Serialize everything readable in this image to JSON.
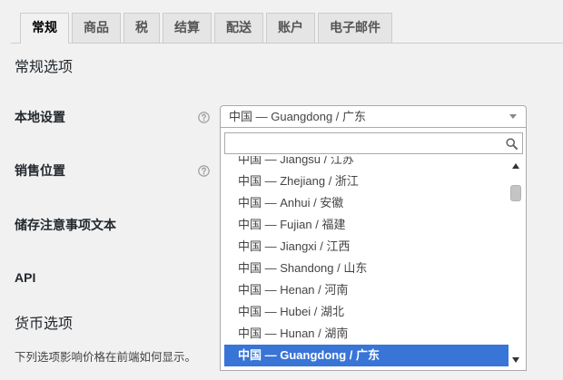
{
  "tabs": [
    {
      "label": "常规",
      "active": true
    },
    {
      "label": "商品",
      "active": false
    },
    {
      "label": "税",
      "active": false
    },
    {
      "label": "结算",
      "active": false
    },
    {
      "label": "配送",
      "active": false
    },
    {
      "label": "账户",
      "active": false
    },
    {
      "label": "电子邮件",
      "active": false
    }
  ],
  "general_options": {
    "heading": "常规选项",
    "fields": {
      "base_location": {
        "label": "本地设置",
        "help_icon": "help-icon"
      },
      "selling_location": {
        "label": "销售位置",
        "help_icon": "help-icon"
      },
      "store_notice_text": {
        "label": "储存注意事项文本"
      },
      "api": {
        "label": "API"
      }
    }
  },
  "base_location_select": {
    "selected": "中国 — Guangdong / 广东",
    "open": true,
    "search_value": "",
    "highlighted_index": 9,
    "options": [
      "中国 — Jiangsu / 江苏",
      "中国 — Zhejiang / 浙江",
      "中国 — Anhui / 安徽",
      "中国 — Fujian / 福建",
      "中国 — Jiangxi / 江西",
      "中国 — Shandong / 山东",
      "中国 — Henan / 河南",
      "中国 — Hubei / 湖北",
      "中国 — Hunan / 湖南",
      "中国 — Guangdong / 广东"
    ]
  },
  "currency_options": {
    "heading": "货币选项",
    "description": "下列选项影响价格在前端如何显示。"
  },
  "icons": {
    "help": "help-icon",
    "dropdown_arrow": "chevron-down-icon",
    "search": "search-icon",
    "scroll_up": "arrow-up-icon",
    "scroll_down": "arrow-down-icon"
  },
  "colors": {
    "page_background": "#f1f1f1",
    "tab_background": "#e5e5e5",
    "border": "#cccccc",
    "highlight": "#3875d7",
    "highlight_text": "#ffffff",
    "text": "#23282d"
  }
}
